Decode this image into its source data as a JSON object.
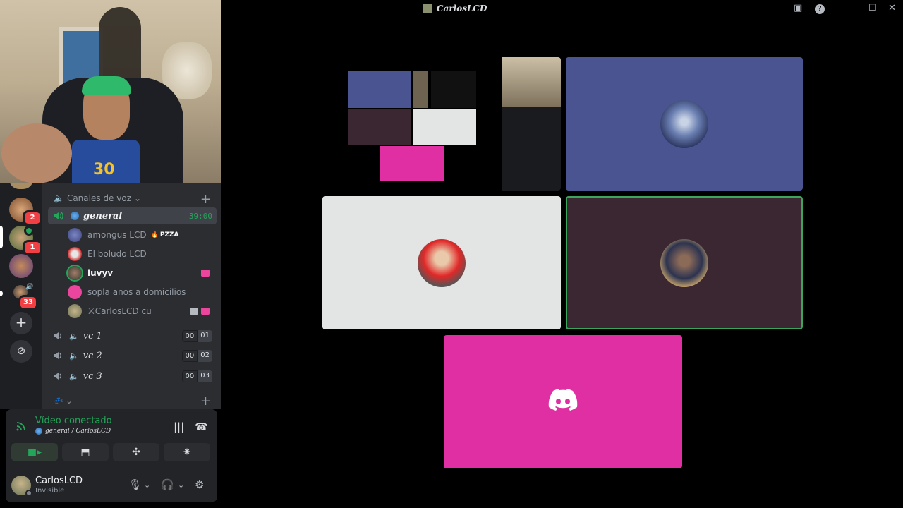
{
  "window": {
    "title": "CarlosLCD",
    "icons": [
      "inbox-icon",
      "help-icon",
      "minimize-icon",
      "maximize-icon",
      "close-icon"
    ]
  },
  "webcam": {
    "shirt_number": "30"
  },
  "rail": {
    "badges": [
      "2",
      "1",
      "33"
    ]
  },
  "channels": {
    "category": "Canales de voz",
    "active_channel": {
      "name": "general",
      "time": "39:00"
    },
    "members": [
      {
        "name": "amongus LCD",
        "tag": "PZZA",
        "color": "#5865f2"
      },
      {
        "name": "El boludo LCD",
        "color": "#ed4245"
      },
      {
        "name": "luvyv",
        "color": "#3ba55c",
        "highlight": true
      },
      {
        "name": "sopla anos a domicilios",
        "color": "#eb459e"
      },
      {
        "name": "⚔CarlosLCD cu",
        "color": "#8a8f6e"
      }
    ],
    "other_channels": [
      {
        "name": "vc 1",
        "left": "00",
        "right": "01"
      },
      {
        "name": "vc 2",
        "left": "00",
        "right": "02"
      },
      {
        "name": "vc 3",
        "left": "00",
        "right": "03"
      }
    ]
  },
  "voice_panel": {
    "status": "Vídeo conectado",
    "location": "general / CarlosLCD"
  },
  "user": {
    "name": "CarlosLCD",
    "status": "Invisible"
  },
  "colors": {
    "accent_green": "#23a55a",
    "tile_blue": "#4a5491",
    "tile_light": "#e3e5e4",
    "tile_dark": "#3b2731",
    "tile_pink": "#e02fa3"
  }
}
